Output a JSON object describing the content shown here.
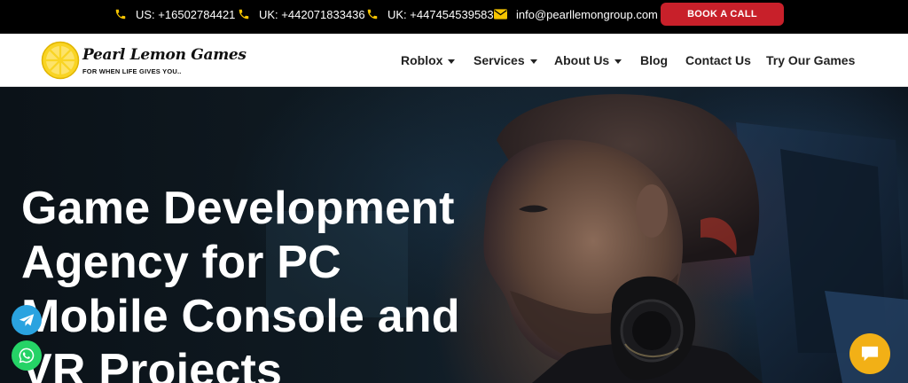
{
  "topbar": {
    "phones": [
      {
        "label": "US: +16502784421"
      },
      {
        "label": "UK: +442071833436"
      },
      {
        "label": "UK: +447454539583"
      }
    ],
    "email": "info@pearllemongroup.com",
    "book_label": "BOOK A CALL",
    "icon_color": "#f5c400"
  },
  "logo": {
    "name": "Pearl Lemon Games",
    "tagline": "FOR WHEN LIFE GIVES YOU.."
  },
  "nav": {
    "items": [
      {
        "label": "Roblox",
        "has_dropdown": true
      },
      {
        "label": "Services",
        "has_dropdown": true
      },
      {
        "label": "About Us",
        "has_dropdown": true
      },
      {
        "label": "Blog",
        "has_dropdown": false
      },
      {
        "label": "Contact Us",
        "has_dropdown": false
      },
      {
        "label": "Try Our Games",
        "has_dropdown": false
      }
    ]
  },
  "hero": {
    "title_lines": [
      "Game Development",
      "Agency for PC",
      "Mobile Console and",
      "VR Projects"
    ]
  },
  "floating": {
    "telegram_icon": "telegram-icon",
    "whatsapp_icon": "whatsapp-icon",
    "chat_icon": "chat-icon"
  },
  "colors": {
    "accent_red": "#c8202a",
    "accent_yellow": "#f5c400",
    "chat_yellow": "#f2b016"
  }
}
